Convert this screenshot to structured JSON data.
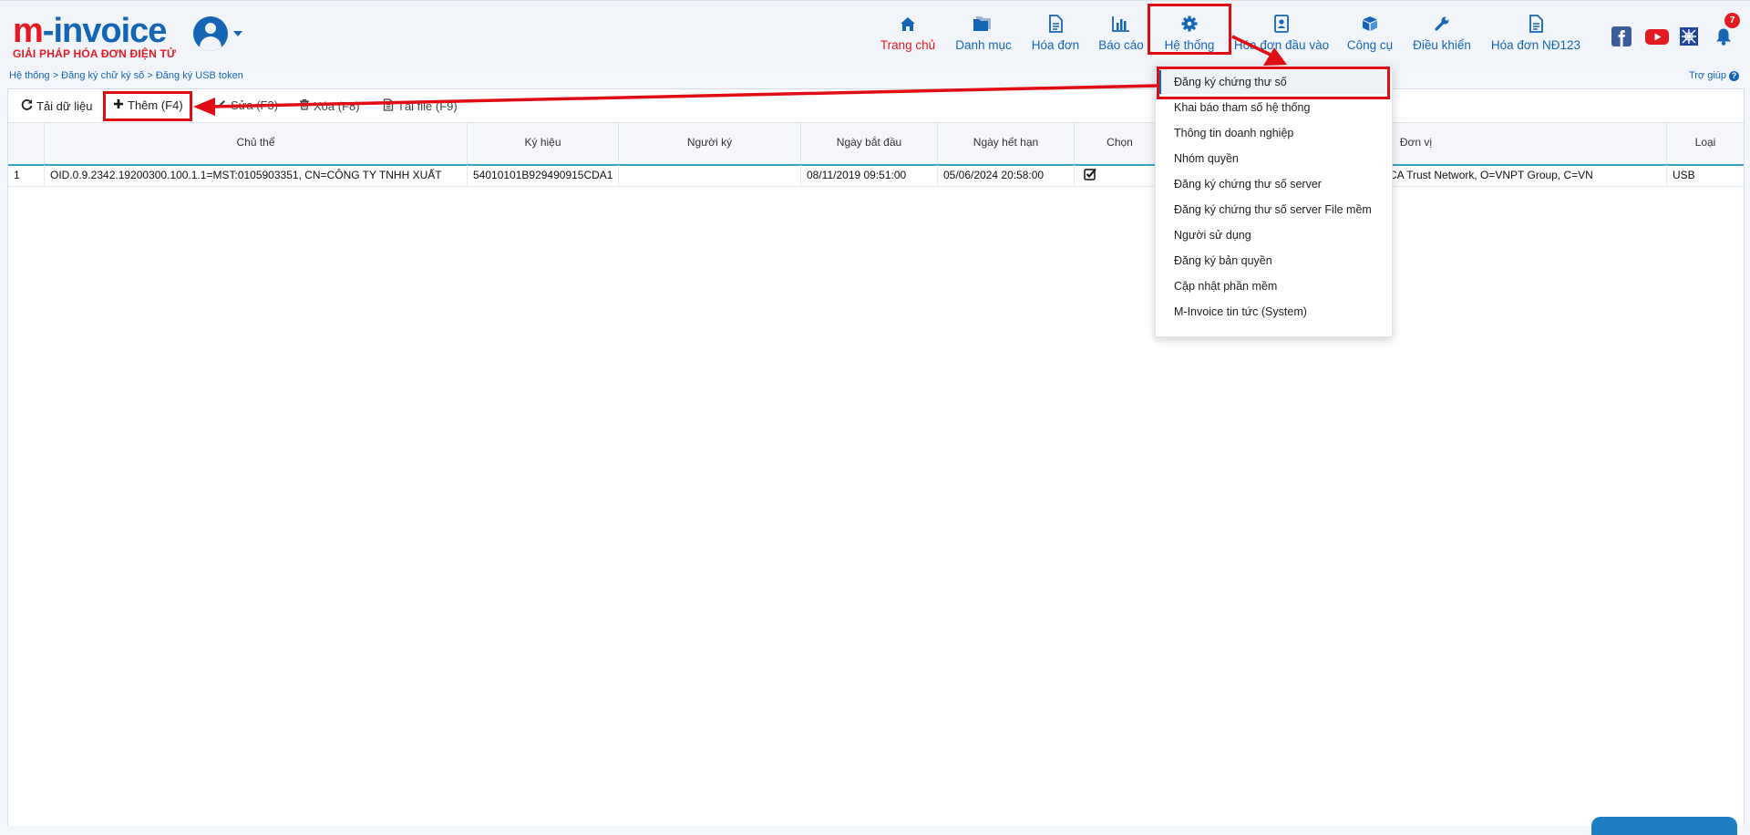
{
  "logo": {
    "part1": "m",
    "part2": "-invoice",
    "tagline": "GIẢI PHÁP HÓA ĐƠN ĐIỆN TỬ"
  },
  "nav": [
    {
      "label": "Trang chủ",
      "icon": "home-icon",
      "active": true
    },
    {
      "label": "Danh mục",
      "icon": "folder-icon"
    },
    {
      "label": "Hóa đơn",
      "icon": "document-icon"
    },
    {
      "label": "Báo cáo",
      "icon": "bar-chart-icon"
    },
    {
      "label": "Hệ thống",
      "icon": "gear-icon"
    },
    {
      "label": "Hóa đơn đầu vào",
      "icon": "contact-book-icon"
    },
    {
      "label": "Công cụ",
      "icon": "box-icon"
    },
    {
      "label": "Điều khiển",
      "icon": "wrench-icon"
    },
    {
      "label": "Hóa đơn NĐ123",
      "icon": "document-icon"
    }
  ],
  "notifications": {
    "count": "7"
  },
  "breadcrumb": "Hệ thống > Đăng ký chữ ký số > Đăng ký USB token",
  "help": "Trợ giúp",
  "toolbar": {
    "reload": "Tải dữ liệu",
    "add": "Thêm (F4)",
    "edit": "Sửa (F3)",
    "delete": "Xóa (F8)",
    "file": "Tải file (F9)"
  },
  "table": {
    "columns": [
      "Chủ thể",
      "Ký hiệu",
      "Người ký",
      "Ngày bắt đầu",
      "Ngày hết hạn",
      "Chọn",
      "Đơn vị",
      "Loại"
    ],
    "rows": [
      {
        "index": "1",
        "subject": "OID.0.9.2342.19200300.100.1.1=MST:0105903351, CN=CÔNG TY TNHH XUẤT",
        "serial": "54010101B929490915CDA1",
        "signer": "",
        "start": "08/11/2019 09:51:00",
        "end": "05/06/2024 20:58:00",
        "selected": true,
        "unit": "CA Trust Network, O=VNPT Group, C=VN",
        "type": "USB"
      }
    ]
  },
  "dropdown": {
    "items": [
      "Đăng ký chứng thư số",
      "Khai báo tham số hệ thống",
      "Thông tin doanh nghiệp",
      "Nhóm quyền",
      "Đăng ký chứng thư số server",
      "Đăng ký chứng thư số server File mềm",
      "Người sử dụng",
      "Đăng ký bản quyền",
      "Cập nhật phần mềm",
      "M-Invoice tin tức (System)"
    ]
  },
  "colors": {
    "brand_blue": "#1565b5",
    "brand_red": "#e21b23",
    "annotation_red": "#e00d14",
    "grid_accent": "#35a6c9"
  }
}
